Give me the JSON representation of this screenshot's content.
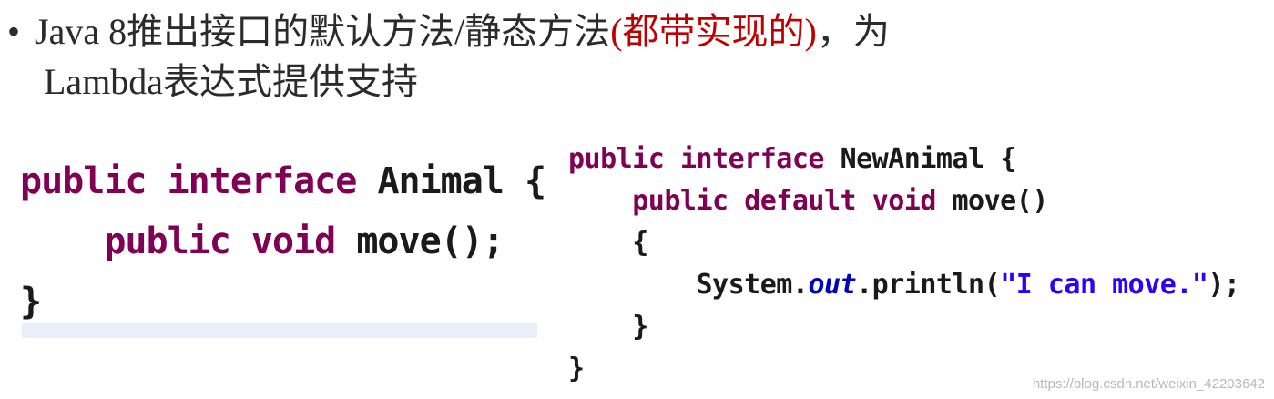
{
  "bullet": {
    "symbol": "•",
    "line1_main": "Java 8推出接口的默认方法/静态方法",
    "line1_red": "(都带实现的)",
    "line1_tail": "，为",
    "line2": "Lambda表达式提供支持"
  },
  "left_code": {
    "kw_public": "public",
    "kw_interface": "interface",
    "name": "Animal",
    "open_brace": "{",
    "kw_public2": "public",
    "kw_void": "void",
    "method": "move();",
    "close_brace": "}"
  },
  "right_code": {
    "kw_public": "public",
    "kw_interface": "interface",
    "name": "NewAnimal",
    "open_brace": "{",
    "kw_public2": "public",
    "kw_default": "default",
    "kw_void": "void",
    "method": "move()",
    "method_open": "{",
    "sys": "System.",
    "out": "out",
    "println": ".println(",
    "string": "\"I can move.\"",
    "stmt_end": ");",
    "method_close": "}",
    "close_brace": "}"
  },
  "watermark": "https://blog.csdn.net/weixin_42203642"
}
